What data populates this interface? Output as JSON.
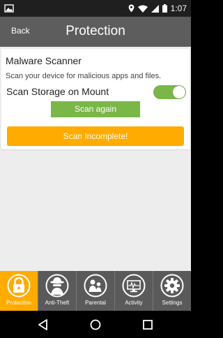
{
  "status_bar": {
    "time": "1:07",
    "left_icon": "photo-icon",
    "right_icons": [
      "location-icon",
      "wifi-icon",
      "signal-icon",
      "battery-icon"
    ]
  },
  "app_bar": {
    "back_label": "Back",
    "title": "Protection"
  },
  "scanner": {
    "title": "Malware Scanner",
    "description": "Scan your device for malicious apps and files.",
    "toggle_label": "Scan Storage on Mount",
    "toggle_on": true,
    "scan_again_label": "Scan again",
    "status_label": "Scan Incomplete!"
  },
  "tabs": [
    {
      "label": "Protection",
      "icon": "lock-icon",
      "active": true
    },
    {
      "label": "Anti-Theft",
      "icon": "spy-icon",
      "active": false
    },
    {
      "label": "Parental",
      "icon": "family-icon",
      "active": false
    },
    {
      "label": "Activity",
      "icon": "monitor-icon",
      "active": false
    },
    {
      "label": "Settings",
      "icon": "gear-icon",
      "active": false
    }
  ],
  "nav_bar": {
    "buttons": [
      "back-icon",
      "home-icon",
      "recents-icon"
    ]
  },
  "colors": {
    "accent_orange": "#ffab00",
    "accent_green": "#7ab648",
    "app_bar": "#5d5d5d",
    "tab_bar": "#5a5a5a"
  }
}
